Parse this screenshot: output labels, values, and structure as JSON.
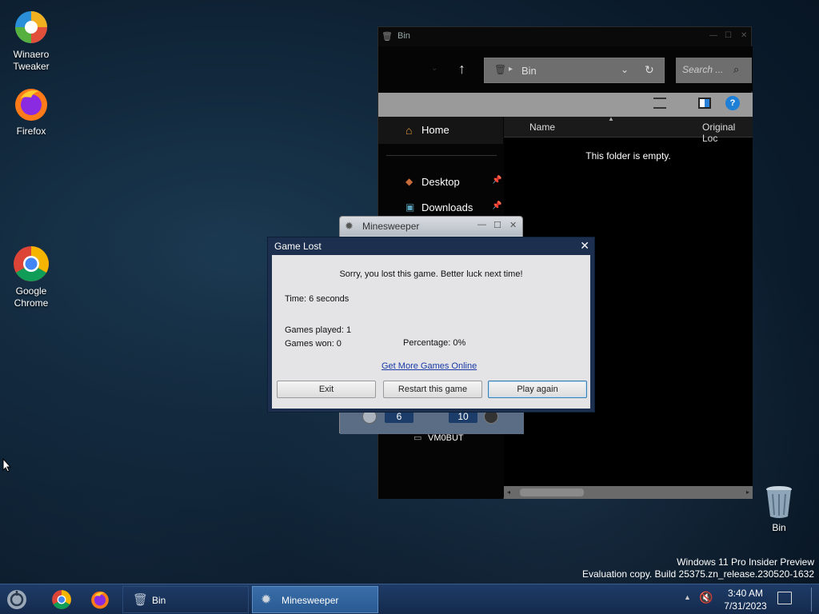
{
  "desktop": {
    "icons": [
      {
        "label": "Winaero Tweaker"
      },
      {
        "label": "Firefox"
      },
      {
        "label": "Google Chrome"
      },
      {
        "label": "Bin"
      }
    ],
    "watermark_line1": "Windows 11 Pro Insider Preview",
    "watermark_line2": "Evaluation copy. Build 25375.zn_release.230520-1632"
  },
  "explorer": {
    "title": "Bin",
    "address": "Bin",
    "search_placeholder": "Search ...",
    "nav": {
      "home": "Home",
      "desktop": "Desktop",
      "downloads": "Downloads",
      "vmbuild": "VM0BUT"
    },
    "columns": {
      "name": "Name",
      "original_location": "Original Loc"
    },
    "empty_message": "This folder is empty."
  },
  "minesweeper": {
    "title": "Minesweeper",
    "time_counter": "6",
    "mine_counter": "10"
  },
  "dialog": {
    "title": "Game Lost",
    "message": "Sorry, you lost this game. Better luck next time!",
    "time": "Time: 6 seconds",
    "games_played": "Games played: 1",
    "games_won": "Games won: 0",
    "percentage": "Percentage: 0%",
    "link": "Get More Games Online",
    "buttons": {
      "exit": "Exit",
      "restart": "Restart this game",
      "play_again": "Play again"
    }
  },
  "taskbar": {
    "apps": [
      {
        "label": "Bin"
      },
      {
        "label": "Minesweeper"
      }
    ],
    "time": "3:40 AM",
    "date": "7/31/2023"
  },
  "colors": {
    "taskbar": "#142a4c",
    "dialog_frame": "#1c2f4e",
    "link": "#1a3aa8"
  }
}
